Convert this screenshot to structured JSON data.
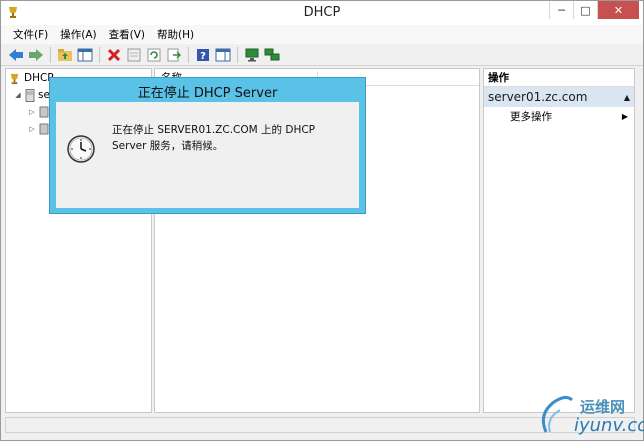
{
  "window": {
    "title": "DHCP",
    "controls": {
      "minimize": "─",
      "maximize": "□",
      "close": "✕"
    }
  },
  "menubar": {
    "items": [
      {
        "label": "文件(F)"
      },
      {
        "label": "操作(A)"
      },
      {
        "label": "查看(V)"
      },
      {
        "label": "帮助(H)"
      }
    ]
  },
  "toolbar": {
    "buttons": [
      "back-icon",
      "forward-icon",
      "up-folder-icon",
      "show-hide-tree-icon",
      "delete-icon",
      "properties-icon",
      "refresh-icon",
      "export-list-icon",
      "help-icon",
      "show-hide-action-pane-icon",
      "monitor-icon",
      "network-icon"
    ]
  },
  "tree": {
    "root_label": "DHCP",
    "server_label": "se"
  },
  "list": {
    "column_name": "名称"
  },
  "actions": {
    "header": "操作",
    "section_title": "server01.zc.com",
    "more_actions": "更多操作"
  },
  "dialog": {
    "title": "正在停止 DHCP Server",
    "message": "正在停止 SERVER01.ZC.COM 上的 DHCP Server 服务，请稍候。"
  },
  "watermark": {
    "top_text": "运维网",
    "bottom_text": "iyunv.com"
  },
  "colors": {
    "dialog_border": "#5bc2e7",
    "actions_section_bg": "#d9e6f2",
    "close_button": "#c75050"
  }
}
